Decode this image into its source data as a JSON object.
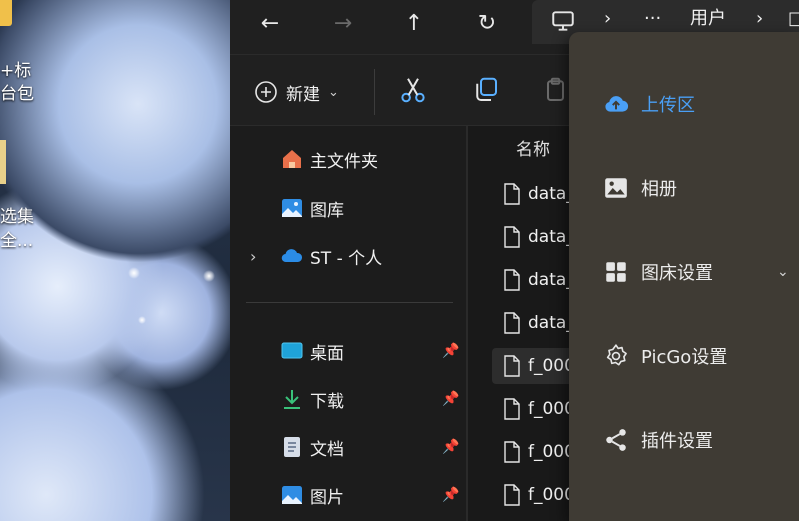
{
  "desktop": {
    "labels": [
      "+标",
      "台包",
      "选集",
      "全..."
    ]
  },
  "explorer": {
    "nav": {
      "back_icon": "←",
      "forward_icon": "→",
      "up_icon": "↑",
      "refresh_icon": "↻",
      "address": {
        "monitor_icon": "monitor-icon",
        "sep1": "›",
        "more": "···",
        "segment": "用户",
        "sep2": "›",
        "tail": "□"
      }
    },
    "toolbar": {
      "new_label": "新建",
      "new_chevron": "⌄"
    },
    "sidebar": {
      "items": [
        {
          "label": "主文件夹",
          "icon": "home-icon"
        },
        {
          "label": "图库",
          "icon": "gallery-icon"
        },
        {
          "label": "ST - 个人",
          "icon": "onedrive-icon",
          "chevron": "›"
        },
        {
          "label": "桌面",
          "icon": "desktop-icon",
          "pin": "📌"
        },
        {
          "label": "下载",
          "icon": "download-icon",
          "pin": "📌"
        },
        {
          "label": "文档",
          "icon": "document-icon",
          "pin": "📌"
        },
        {
          "label": "图片",
          "icon": "pictures-icon",
          "pin": "📌"
        }
      ]
    },
    "files": {
      "column_name": "名称",
      "rows": [
        "data_",
        "data_",
        "data_",
        "data_",
        "f_000",
        "f_000",
        "f_000",
        "f_000"
      ]
    }
  },
  "picgo_menu": {
    "accent": "#4a9ff5",
    "items": [
      {
        "label": "上传区",
        "icon": "upload-cloud-icon",
        "active": true
      },
      {
        "label": "相册",
        "icon": "album-icon"
      },
      {
        "label": "图床设置",
        "icon": "grid-icon",
        "chevron": "⌄"
      },
      {
        "label": "PicGo设置",
        "icon": "gear-icon"
      },
      {
        "label": "插件设置",
        "icon": "share-icon"
      }
    ]
  }
}
